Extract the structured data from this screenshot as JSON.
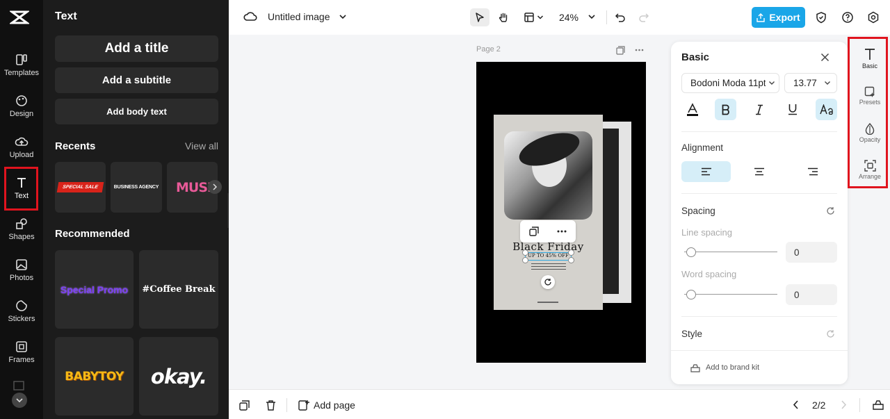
{
  "rail": {
    "items": [
      {
        "label": "Templates",
        "icon": "templates-icon"
      },
      {
        "label": "Design",
        "icon": "design-icon"
      },
      {
        "label": "Upload",
        "icon": "upload-icon"
      },
      {
        "label": "Text",
        "icon": "text-icon"
      },
      {
        "label": "Shapes",
        "icon": "shapes-icon"
      },
      {
        "label": "Photos",
        "icon": "photos-icon"
      },
      {
        "label": "Stickers",
        "icon": "stickers-icon"
      },
      {
        "label": "Frames",
        "icon": "frames-icon"
      }
    ]
  },
  "panel": {
    "title": "Text",
    "add_title": "Add a title",
    "add_subtitle": "Add a subtitle",
    "add_body": "Add body text",
    "recents_label": "Recents",
    "view_all": "View all",
    "recents": [
      "SPECIAL SALE",
      "BUSINESS AGENCY",
      "MUSIC"
    ],
    "recommended_label": "Recommended",
    "recommended": [
      "Special Promo",
      "#Coffee Break",
      "BABYTOY",
      "okay."
    ]
  },
  "topbar": {
    "doc_title": "Untitled image",
    "zoom": "24%",
    "export_label": "Export"
  },
  "canvas": {
    "page_label": "Page 2",
    "design_heading": "Black Friday",
    "design_sub": "UP TO 45% OFF"
  },
  "bottombar": {
    "add_page": "Add page",
    "page_counter": "2/2"
  },
  "props": {
    "title": "Basic",
    "font_family": "Bodoni Moda 11pt",
    "font_size": "13.77",
    "alignment_label": "Alignment",
    "spacing_label": "Spacing",
    "line_spacing_label": "Line spacing",
    "line_spacing_value": "0",
    "word_spacing_label": "Word spacing",
    "word_spacing_value": "0",
    "style_label": "Style",
    "brand_kit": "Add to brand kit"
  },
  "side_tabs": [
    {
      "label": "Basic"
    },
    {
      "label": "Presets"
    },
    {
      "label": "Opacity"
    },
    {
      "label": "Arrange"
    }
  ],
  "colors": {
    "accent": "#1aa6e8",
    "highlight": "#e0141e",
    "active_bg": "#d6eef8"
  }
}
